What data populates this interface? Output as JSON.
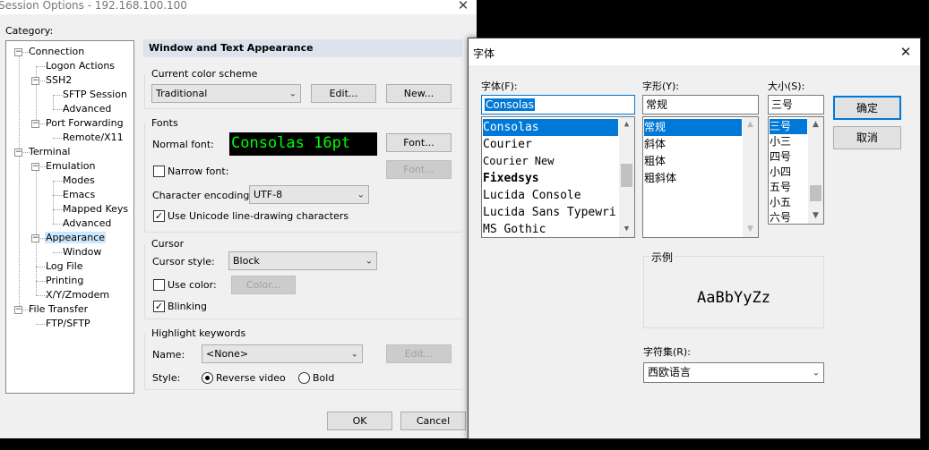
{
  "session_window": {
    "title": "Session Options - 192.168.100.100",
    "category_label": "Category:",
    "tree": [
      {
        "label": "Connection",
        "level": 0,
        "expander": "−"
      },
      {
        "label": "Logon Actions",
        "level": 1
      },
      {
        "label": "SSH2",
        "level": 1,
        "expander": "−"
      },
      {
        "label": "SFTP Session",
        "level": 2
      },
      {
        "label": "Advanced",
        "level": 2
      },
      {
        "label": "Port Forwarding",
        "level": 1,
        "expander": "−"
      },
      {
        "label": "Remote/X11",
        "level": 2
      },
      {
        "label": "Terminal",
        "level": 0,
        "expander": "−"
      },
      {
        "label": "Emulation",
        "level": 1,
        "expander": "−"
      },
      {
        "label": "Modes",
        "level": 2
      },
      {
        "label": "Emacs",
        "level": 2
      },
      {
        "label": "Mapped Keys",
        "level": 2
      },
      {
        "label": "Advanced",
        "level": 2
      },
      {
        "label": "Appearance",
        "level": 1,
        "expander": "−",
        "selected": true
      },
      {
        "label": "Window",
        "level": 2
      },
      {
        "label": "Log File",
        "level": 1
      },
      {
        "label": "Printing",
        "level": 1
      },
      {
        "label": "X/Y/Zmodem",
        "level": 1
      },
      {
        "label": "File Transfer",
        "level": 0,
        "expander": "−"
      },
      {
        "label": "FTP/SFTP",
        "level": 1
      }
    ],
    "panel_header": "Window and Text Appearance",
    "color_scheme": {
      "label": "Current color scheme",
      "value": "Traditional",
      "edit_button": "Edit...",
      "new_button": "New..."
    },
    "fonts": {
      "label": "Fonts",
      "normal_font_label": "Normal font:",
      "normal_font_preview": "Consolas 16pt",
      "preview_color": "#00ff00",
      "font_button": "Font...",
      "narrow_font_label": "Narrow font:",
      "narrow_font_button": "Font...",
      "encoding_label": "Character encoding:",
      "encoding_value": "UTF-8",
      "unicode_label": "Use Unicode line-drawing characters"
    },
    "cursor": {
      "label": "Cursor",
      "style_label": "Cursor style:",
      "style_value": "Block",
      "use_color_label": "Use color:",
      "color_button": "Color...",
      "blinking_label": "Blinking"
    },
    "highlight": {
      "label": "Highlight keywords",
      "name_label": "Name:",
      "name_value": "<None>",
      "edit_button": "Edit...",
      "style_label": "Style:",
      "reverse_label": "Reverse video",
      "bold_label": "Bold"
    },
    "ok_button": "OK",
    "cancel_button": "Cancel"
  },
  "font_dialog": {
    "title": "字体",
    "font_label": "字体(F):",
    "font_value": "Consolas",
    "fonts": [
      "Consolas",
      "Courier",
      "Courier New",
      "Fixedsys",
      "Lucida Console",
      "Lucida Sans Typewri",
      "MS Gothic"
    ],
    "style_label": "字形(Y):",
    "style_value": "常规",
    "styles": [
      "常规",
      "斜体",
      "粗体",
      "粗斜体"
    ],
    "size_label": "大小(S):",
    "size_value": "三号",
    "sizes": [
      "三号",
      "小三",
      "四号",
      "小四",
      "五号",
      "小五",
      "六号"
    ],
    "ok_button": "确定",
    "cancel_button": "取消",
    "sample_label": "示例",
    "sample_text": "AaBbYyZz",
    "charset_label": "字符集(R):",
    "charset_value": "西欧语言"
  }
}
